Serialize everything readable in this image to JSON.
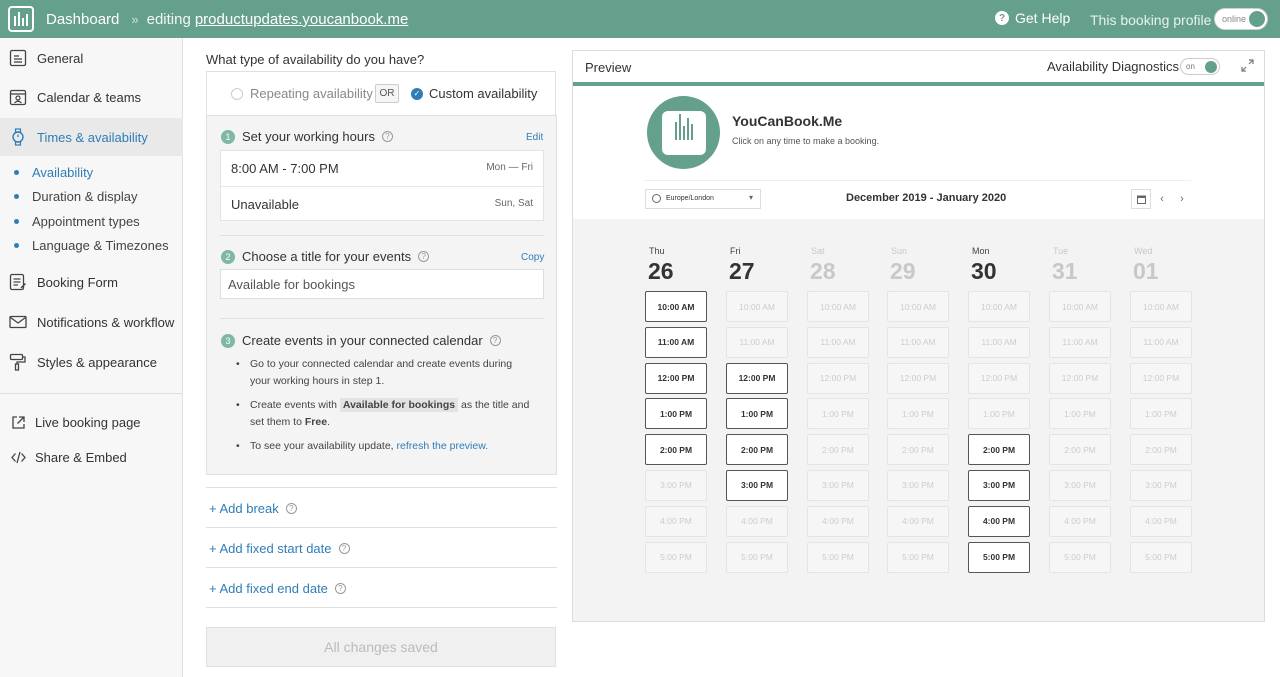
{
  "topbar": {
    "dashboard": "Dashboard",
    "separator": "»",
    "editing": "editing",
    "domain": "productupdates.youcanbook.me",
    "help": "Get Help",
    "profile_status_label": "This booking profile is",
    "profile_toggle": "online"
  },
  "sidebar": {
    "items": [
      {
        "label": "General",
        "icon": "profile-card-icon"
      },
      {
        "label": "Calendar & teams",
        "icon": "calendar-person-icon"
      },
      {
        "label": "Times & availability",
        "icon": "watch-icon"
      }
    ],
    "sub_items": [
      {
        "label": "Availability"
      },
      {
        "label": "Duration & display"
      },
      {
        "label": "Appointment types"
      },
      {
        "label": "Language & Timezones"
      }
    ],
    "items2": [
      {
        "label": "Booking Form",
        "icon": "form-icon"
      },
      {
        "label": "Notifications & workflow",
        "icon": "mail-icon"
      },
      {
        "label": "Styles & appearance",
        "icon": "paint-roller-icon"
      }
    ],
    "links": [
      {
        "label": "Live booking page",
        "icon": "external-link-icon"
      },
      {
        "label": "Share & Embed",
        "icon": "code-icon"
      }
    ]
  },
  "availability": {
    "question": "What type of availability do you have?",
    "option_repeating": "Repeating availability",
    "or_label": "OR",
    "option_custom": "Custom availability",
    "step1": {
      "num": "1",
      "title": "Set your working hours",
      "action": "Edit"
    },
    "hours": [
      {
        "time": "8:00 AM - 7:00 PM",
        "days": "Mon — Fri"
      },
      {
        "time": "Unavailable",
        "days": "Sun, Sat"
      }
    ],
    "step2": {
      "num": "2",
      "title": "Choose a title for your events",
      "action": "Copy",
      "input_value": "Available for bookings"
    },
    "step3": {
      "num": "3",
      "title": "Create events in your connected calendar",
      "bullet1": "Go to your connected calendar and create events during your working hours in step 1.",
      "bullet2_pre": "Create events with",
      "bullet2_highlight": "Available for bookings",
      "bullet2_mid": "as the title and set them to",
      "bullet2_bold": "Free",
      "bullet2_end": ".",
      "bullet3_pre": "To see your availability update,",
      "bullet3_link": "refresh the preview."
    },
    "add_break": "+ Add break",
    "add_start": "+ Add fixed start date",
    "add_end": "+ Add fixed end date",
    "save_status": "All changes saved"
  },
  "preview": {
    "title": "Preview",
    "diagnostics": "Availability Diagnostics",
    "diagnostics_toggle": "on",
    "brand_name": "YouCanBook.Me",
    "brand_sub": "Click on any time to make a booking.",
    "timezone": "Europe/London",
    "date_range": "December 2019 - January 2020",
    "days": [
      {
        "name": "Thu",
        "num": "26",
        "faded": false,
        "available": [
          1,
          1,
          1,
          1,
          1,
          0,
          0,
          0
        ]
      },
      {
        "name": "Fri",
        "num": "27",
        "faded": false,
        "available": [
          0,
          0,
          1,
          1,
          1,
          1,
          0,
          0
        ]
      },
      {
        "name": "Sat",
        "num": "28",
        "faded": true,
        "available": [
          0,
          0,
          0,
          0,
          0,
          0,
          0,
          0
        ]
      },
      {
        "name": "Sun",
        "num": "29",
        "faded": true,
        "available": [
          0,
          0,
          0,
          0,
          0,
          0,
          0,
          0
        ]
      },
      {
        "name": "Mon",
        "num": "30",
        "faded": false,
        "available": [
          0,
          0,
          0,
          0,
          1,
          1,
          1,
          1
        ]
      },
      {
        "name": "Tue",
        "num": "31",
        "faded": true,
        "available": [
          0,
          0,
          0,
          0,
          0,
          0,
          0,
          0
        ]
      },
      {
        "name": "Wed",
        "num": "01",
        "faded": true,
        "available": [
          0,
          0,
          0,
          0,
          0,
          0,
          0,
          0
        ]
      }
    ],
    "slots": [
      "10:00 AM",
      "11:00 AM",
      "12:00 PM",
      "1:00 PM",
      "2:00 PM",
      "3:00 PM",
      "4:00 PM",
      "5:00 PM"
    ]
  }
}
